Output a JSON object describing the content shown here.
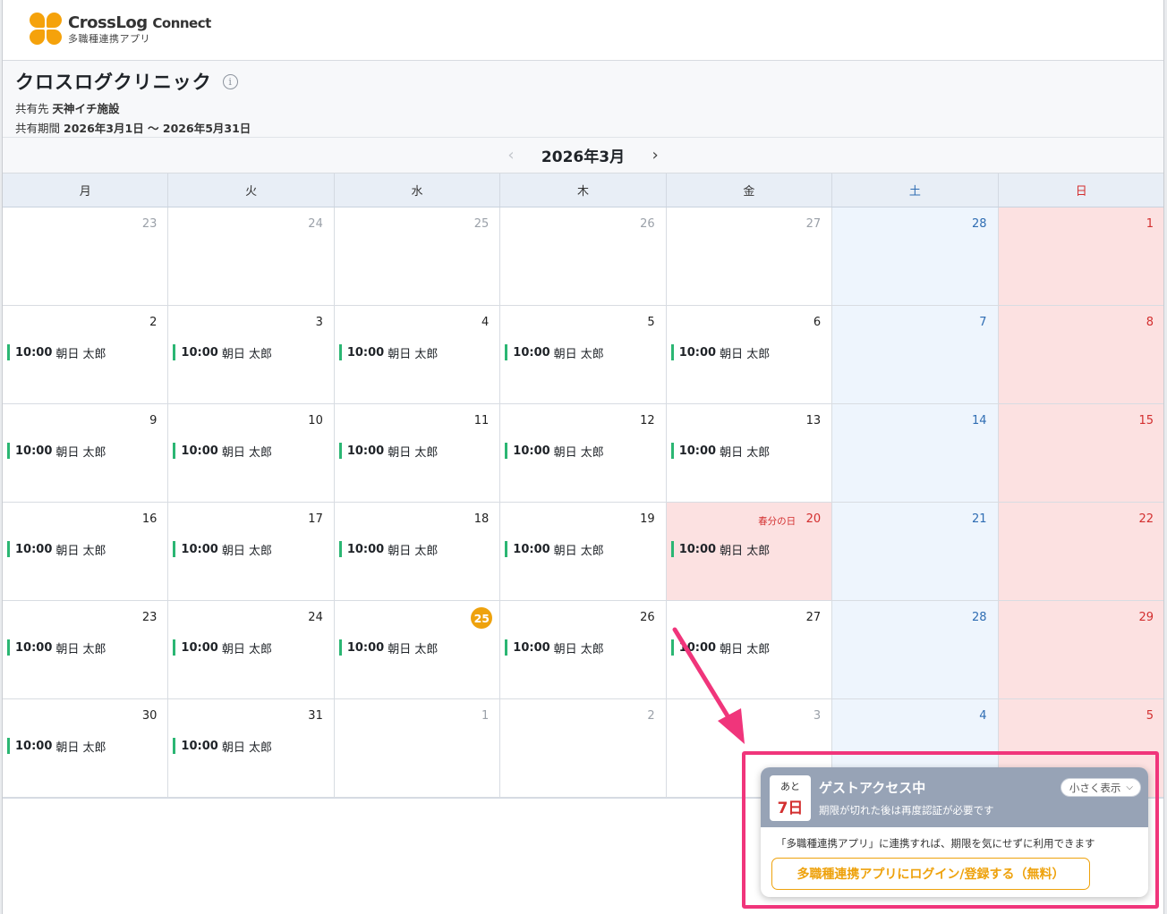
{
  "app": {
    "logo_title": "CrossLog",
    "logo_title_suffix": "Connect",
    "logo_sub": "多職種連携アプリ"
  },
  "clinic": {
    "name": "クロスログクリニック",
    "share_to_label": "共有先",
    "share_to_value": "天神イチ施設",
    "period_label": "共有期間",
    "period_value": "2026年3月1日 〜 2026年5月31日"
  },
  "nav": {
    "month": "2026年3月",
    "prev": "‹",
    "next": "›"
  },
  "weekdays": [
    "月",
    "火",
    "水",
    "木",
    "金",
    "土",
    "日"
  ],
  "event_template": {
    "time": "10:00",
    "name": "朝日 太郎"
  },
  "weeks": [
    [
      {
        "day": "23",
        "type": "other"
      },
      {
        "day": "24",
        "type": "other"
      },
      {
        "day": "25",
        "type": "other"
      },
      {
        "day": "26",
        "type": "other"
      },
      {
        "day": "27",
        "type": "other"
      },
      {
        "day": "28",
        "type": "sat"
      },
      {
        "day": "1",
        "type": "sun"
      }
    ],
    [
      {
        "day": "2",
        "event": true
      },
      {
        "day": "3",
        "event": true
      },
      {
        "day": "4",
        "event": true
      },
      {
        "day": "5",
        "event": true
      },
      {
        "day": "6",
        "event": true
      },
      {
        "day": "7",
        "type": "sat"
      },
      {
        "day": "8",
        "type": "sun"
      }
    ],
    [
      {
        "day": "9",
        "event": true
      },
      {
        "day": "10",
        "event": true
      },
      {
        "day": "11",
        "event": true
      },
      {
        "day": "12",
        "event": true
      },
      {
        "day": "13",
        "event": true
      },
      {
        "day": "14",
        "type": "sat"
      },
      {
        "day": "15",
        "type": "sun"
      }
    ],
    [
      {
        "day": "16",
        "event": true
      },
      {
        "day": "17",
        "event": true
      },
      {
        "day": "18",
        "event": true
      },
      {
        "day": "19",
        "event": true
      },
      {
        "day": "20",
        "event": true,
        "type": "holiday",
        "holiday": "春分の日"
      },
      {
        "day": "21",
        "type": "sat"
      },
      {
        "day": "22",
        "type": "sun"
      }
    ],
    [
      {
        "day": "23",
        "event": true
      },
      {
        "day": "24",
        "event": true
      },
      {
        "day": "25",
        "event": true,
        "today": true
      },
      {
        "day": "26",
        "event": true
      },
      {
        "day": "27",
        "event": true
      },
      {
        "day": "28",
        "type": "sat"
      },
      {
        "day": "29",
        "type": "sun"
      }
    ],
    [
      {
        "day": "30",
        "event": true
      },
      {
        "day": "31",
        "event": true
      },
      {
        "day": "1",
        "type": "other"
      },
      {
        "day": "2",
        "type": "other"
      },
      {
        "day": "3",
        "type": "other"
      },
      {
        "day": "4",
        "type": "sat"
      },
      {
        "day": "5",
        "type": "sun"
      }
    ]
  ],
  "guest_panel": {
    "days_prefix": "あと",
    "days_left": "7日",
    "title": "ゲストアクセス中",
    "subtitle": "期限が切れた後は再度認証が必要です",
    "minimize_label": "小さく表示",
    "note": "「多職種連携アプリ」に連携すれば、期限を気にせずに利用できます",
    "cta_label": "多職種連携アプリにログイン/登録する（無料）"
  },
  "colors": {
    "accent": "#eea20d",
    "event_bar": "#2bb673",
    "saturday": "#2f6db3",
    "sunday": "#d32f2f",
    "highlight": "#f0357b"
  }
}
